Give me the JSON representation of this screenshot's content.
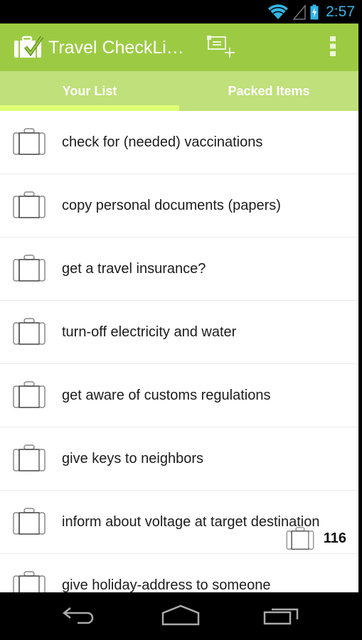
{
  "status_bar": {
    "time": "2:57",
    "icons": [
      "wifi-icon",
      "signal-icon",
      "battery-charging-icon"
    ],
    "accent_color": "#33b5e5"
  },
  "action_bar": {
    "title": "Travel CheckLi…",
    "logo_icon": "suitcase-check-icon",
    "actions": [
      {
        "name": "add-list-item",
        "icon": "add-item-icon"
      },
      {
        "name": "list-view",
        "icon": "list-icon"
      },
      {
        "name": "overflow-menu",
        "icon": "more-vert-icon"
      }
    ],
    "color": "#9ccb43"
  },
  "tabs": [
    {
      "label": "Your List",
      "active": true
    },
    {
      "label": "Packed Items",
      "active": false
    }
  ],
  "tab_colors": {
    "background": "#bfe07a",
    "indicator": "#deff73"
  },
  "items": [
    {
      "label": "check for (needed) vaccinations",
      "icon": "suitcase-icon"
    },
    {
      "label": "copy personal documents (papers)",
      "icon": "suitcase-icon"
    },
    {
      "label": "get a travel insurance?",
      "icon": "suitcase-icon"
    },
    {
      "label": "turn-off electricity and water",
      "icon": "suitcase-icon"
    },
    {
      "label": "get aware of customs regulations",
      "icon": "suitcase-icon"
    },
    {
      "label": "give keys to neighbors",
      "icon": "suitcase-icon"
    },
    {
      "label": "inform about voltage at target destination",
      "icon": "suitcase-icon"
    },
    {
      "label": "give holiday-address to someone",
      "icon": "suitcase-icon"
    }
  ],
  "counter": {
    "value": "116",
    "icon": "suitcase-icon"
  },
  "nav_bar": {
    "buttons": [
      "back",
      "home",
      "recents"
    ]
  }
}
